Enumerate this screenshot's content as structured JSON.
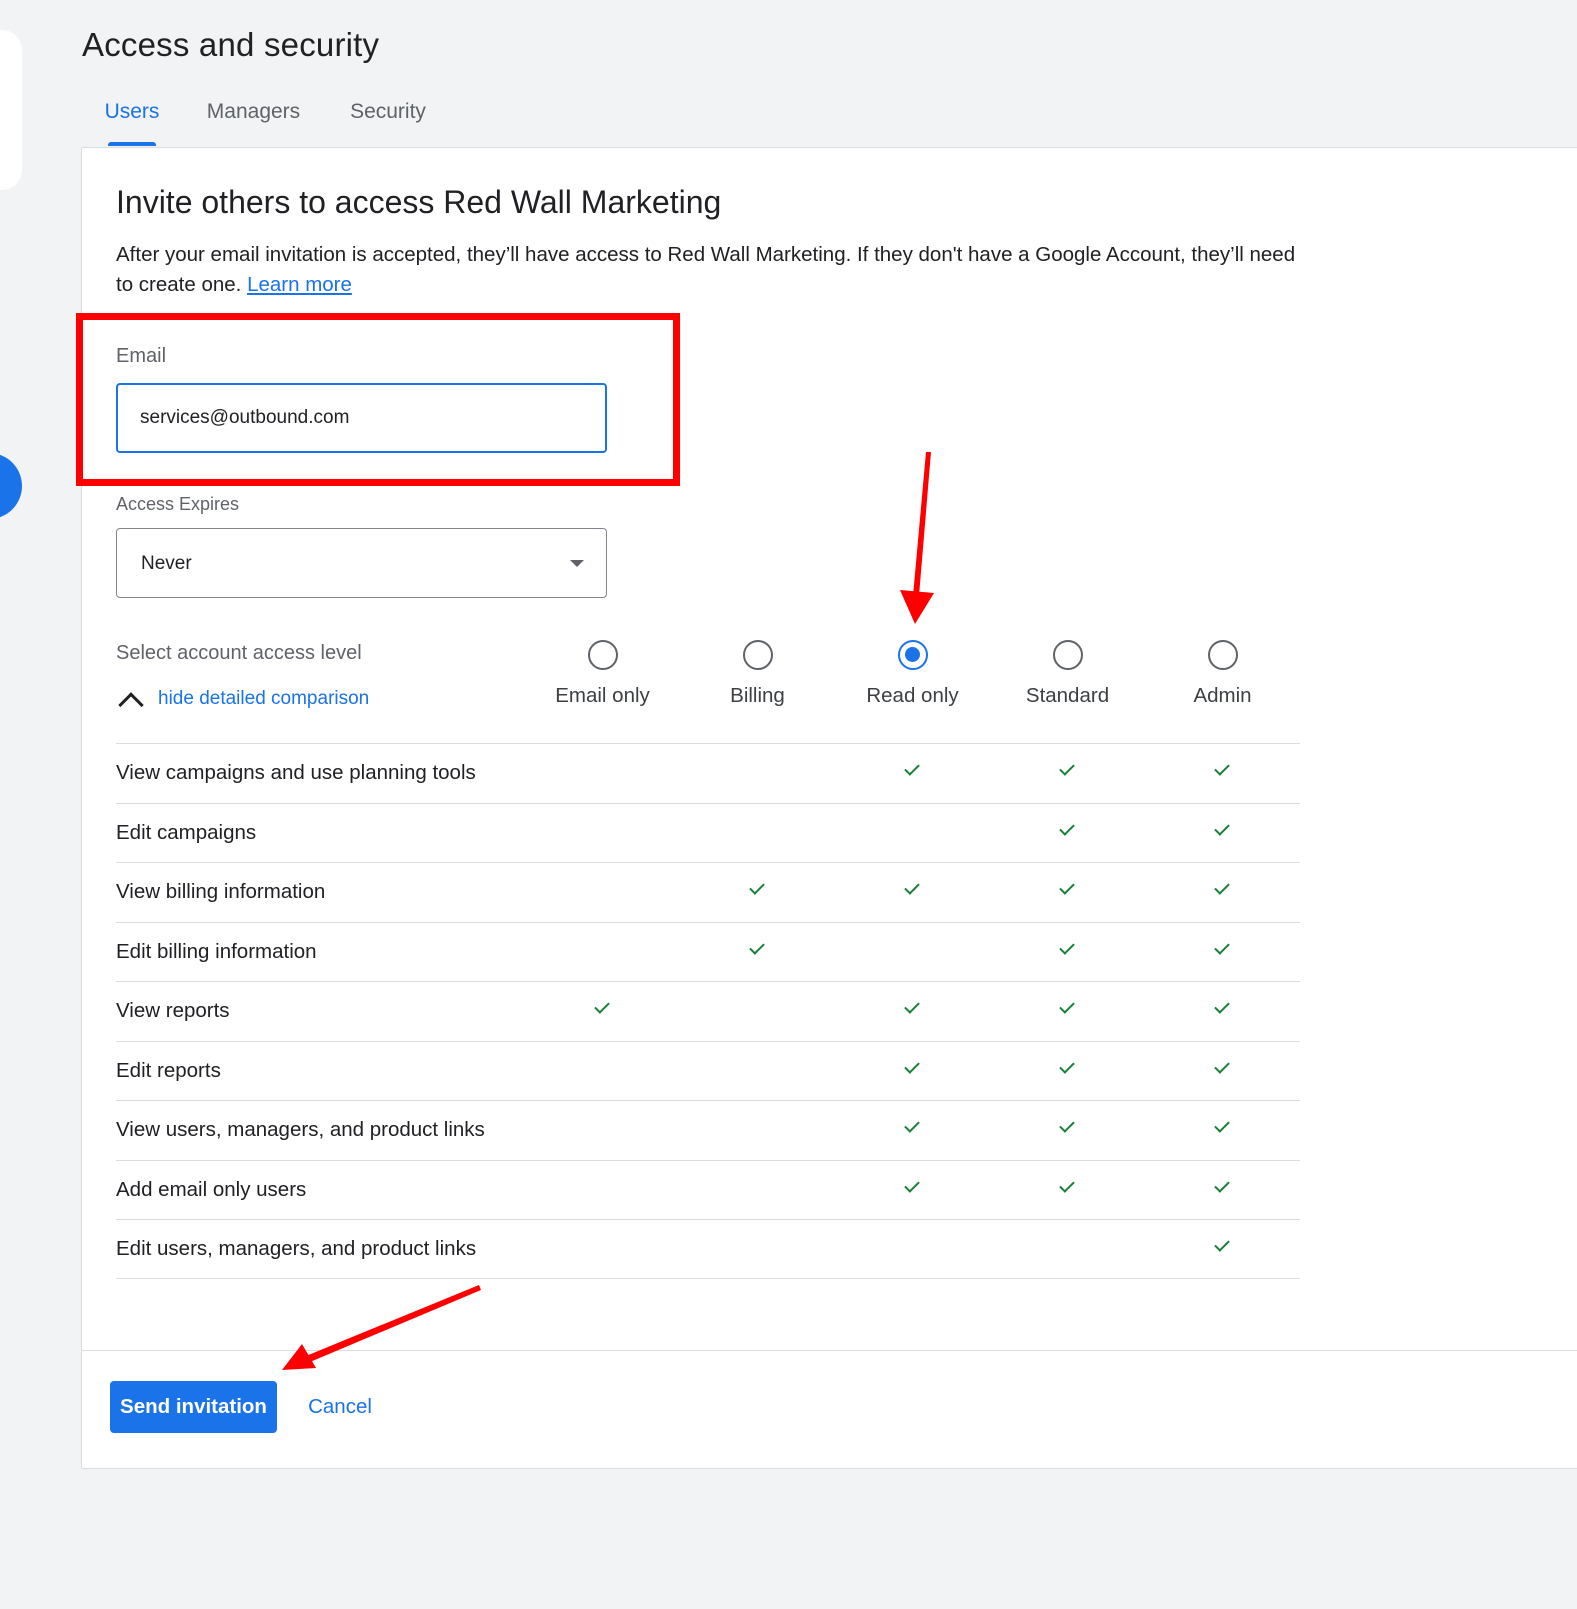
{
  "page": {
    "title": "Access and security"
  },
  "tabs": [
    {
      "label": "Users",
      "active": true
    },
    {
      "label": "Managers",
      "active": false
    },
    {
      "label": "Security",
      "active": false
    }
  ],
  "invite": {
    "title": "Invite others to access Red Wall Marketing",
    "description": "After your email invitation is accepted, they’ll have access to Red Wall Marketing. If they don't have a Google Account, they’ll need to create one.",
    "learn_more": "Learn more"
  },
  "email": {
    "label": "Email",
    "value": "services@outbound.com"
  },
  "access_expires": {
    "label": "Access Expires",
    "value": "Never"
  },
  "access_level": {
    "label": "Select account access level",
    "toggle": "hide detailed comparison",
    "selected": "Read only",
    "options": [
      "Email only",
      "Billing",
      "Read only",
      "Standard",
      "Admin"
    ]
  },
  "permissions": [
    {
      "label": "View campaigns and use planning tools",
      "levels": [
        false,
        false,
        true,
        true,
        true
      ]
    },
    {
      "label": "Edit campaigns",
      "levels": [
        false,
        false,
        false,
        true,
        true
      ]
    },
    {
      "label": "View billing information",
      "levels": [
        false,
        true,
        true,
        true,
        true
      ]
    },
    {
      "label": "Edit billing information",
      "levels": [
        false,
        true,
        false,
        true,
        true
      ]
    },
    {
      "label": "View reports",
      "levels": [
        true,
        false,
        true,
        true,
        true
      ]
    },
    {
      "label": "Edit reports",
      "levels": [
        false,
        false,
        true,
        true,
        true
      ]
    },
    {
      "label": "View users, managers, and product links",
      "levels": [
        false,
        false,
        true,
        true,
        true
      ]
    },
    {
      "label": "Add email only users",
      "levels": [
        false,
        false,
        true,
        true,
        true
      ]
    },
    {
      "label": "Edit users, managers, and product links",
      "levels": [
        false,
        false,
        false,
        false,
        true
      ]
    }
  ],
  "actions": {
    "send": "Send invitation",
    "cancel": "Cancel"
  },
  "colors": {
    "accent": "#1a73e8",
    "check": "#188038",
    "annotation": "#ff0000"
  }
}
